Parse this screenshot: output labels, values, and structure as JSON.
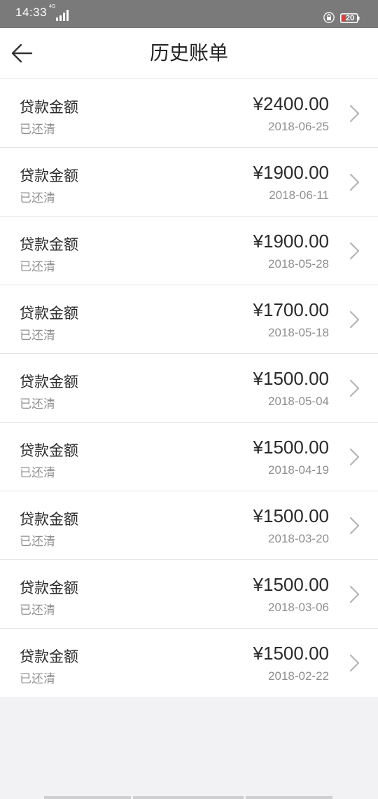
{
  "status_bar": {
    "time": "14:33",
    "network": "4G",
    "battery_level": "20"
  },
  "header": {
    "title": "历史账单"
  },
  "bills": [
    {
      "label": "贷款金额",
      "status": "已还清",
      "amount": "¥2400.00",
      "date": "2018-06-25"
    },
    {
      "label": "贷款金额",
      "status": "已还清",
      "amount": "¥1900.00",
      "date": "2018-06-11"
    },
    {
      "label": "贷款金额",
      "status": "已还清",
      "amount": "¥1900.00",
      "date": "2018-05-28"
    },
    {
      "label": "贷款金额",
      "status": "已还清",
      "amount": "¥1700.00",
      "date": "2018-05-18"
    },
    {
      "label": "贷款金额",
      "status": "已还清",
      "amount": "¥1500.00",
      "date": "2018-05-04"
    },
    {
      "label": "贷款金额",
      "status": "已还清",
      "amount": "¥1500.00",
      "date": "2018-04-19"
    },
    {
      "label": "贷款金额",
      "status": "已还清",
      "amount": "¥1500.00",
      "date": "2018-03-20"
    },
    {
      "label": "贷款金额",
      "status": "已还清",
      "amount": "¥1500.00",
      "date": "2018-03-06"
    },
    {
      "label": "贷款金额",
      "status": "已还清",
      "amount": "¥1500.00",
      "date": "2018-02-22"
    }
  ],
  "colors": {
    "status_bar": "#7a7a7a",
    "battery_low": "#e53935",
    "background": "#f2f2f4"
  }
}
